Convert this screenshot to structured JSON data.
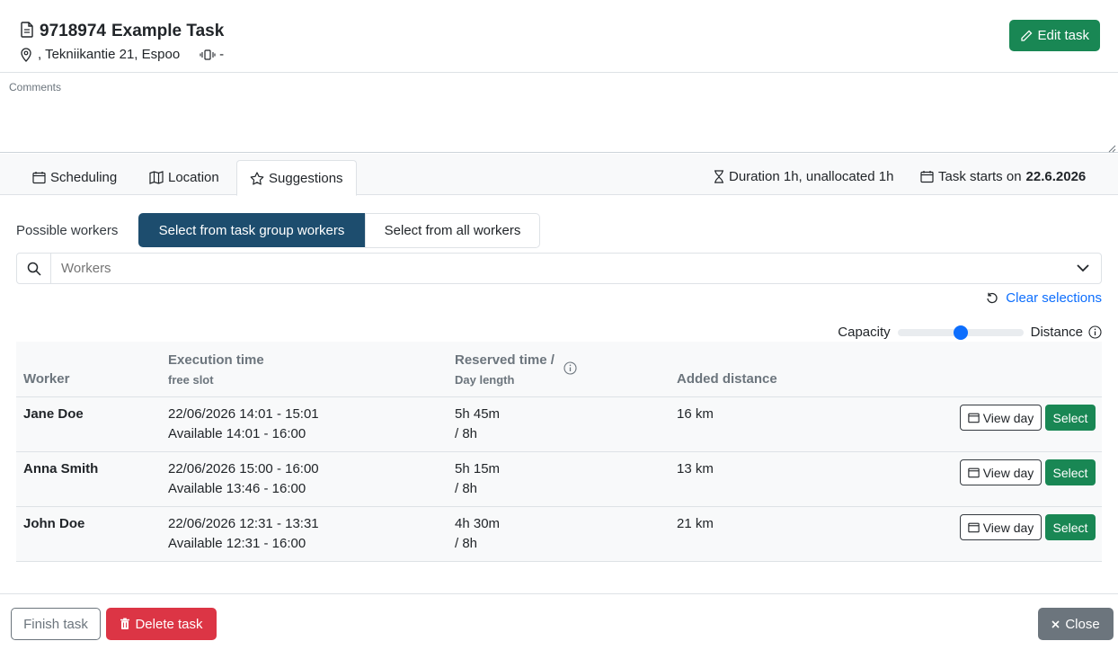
{
  "header": {
    "task_id": "9718974",
    "task_name": "Example Task",
    "address": ", Tekniikantie 21, Espoo",
    "vehicle": "-",
    "edit_label": "Edit task"
  },
  "comments": {
    "label": "Comments"
  },
  "tabs": [
    {
      "label": "Scheduling",
      "icon": "calendar-icon"
    },
    {
      "label": "Location",
      "icon": "map-icon"
    },
    {
      "label": "Suggestions",
      "icon": "star-icon"
    }
  ],
  "tab_info": {
    "duration": "Duration 1h, unallocated 1h",
    "starts_prefix": "Task starts on",
    "starts_date": "22.6.2026"
  },
  "suggestions": {
    "possible_label": "Possible workers",
    "seg_group": "Select from task group workers",
    "seg_all": "Select from all workers",
    "workers_placeholder": "Workers",
    "clear_label": "Clear selections",
    "slider_left": "Capacity",
    "slider_right": "Distance",
    "slider_value": 0.5
  },
  "table": {
    "headers": {
      "worker": "Worker",
      "exec": "Execution time",
      "exec_sub": "free slot",
      "reserved": "Reserved time /",
      "reserved_sub": "Day length",
      "distance": "Added distance"
    },
    "view_day_label": "View day",
    "select_label": "Select",
    "rows": [
      {
        "worker": "Jane Doe",
        "exec": "22/06/2026 14:01 - 15:01",
        "available": "Available 14:01 - 16:00",
        "reserved": "5h 45m",
        "day": "/ 8h",
        "distance": "16 km"
      },
      {
        "worker": "Anna Smith",
        "exec": "22/06/2026 15:00 - 16:00",
        "available": "Available 13:46 - 16:00",
        "reserved": "5h 15m",
        "day": "/ 8h",
        "distance": "13 km"
      },
      {
        "worker": "John Doe",
        "exec": "22/06/2026 12:31 - 13:31",
        "available": "Available 12:31 - 16:00",
        "reserved": "4h 30m",
        "day": "/ 8h",
        "distance": "21 km"
      }
    ]
  },
  "footer": {
    "finish_label": "Finish task",
    "delete_label": "Delete task",
    "close_label": "Close"
  },
  "colors": {
    "success": "#198754",
    "danger": "#dc3545",
    "primary": "#0d6efd",
    "dark_blue": "#1d4d6e",
    "secondary": "#6c757d"
  }
}
